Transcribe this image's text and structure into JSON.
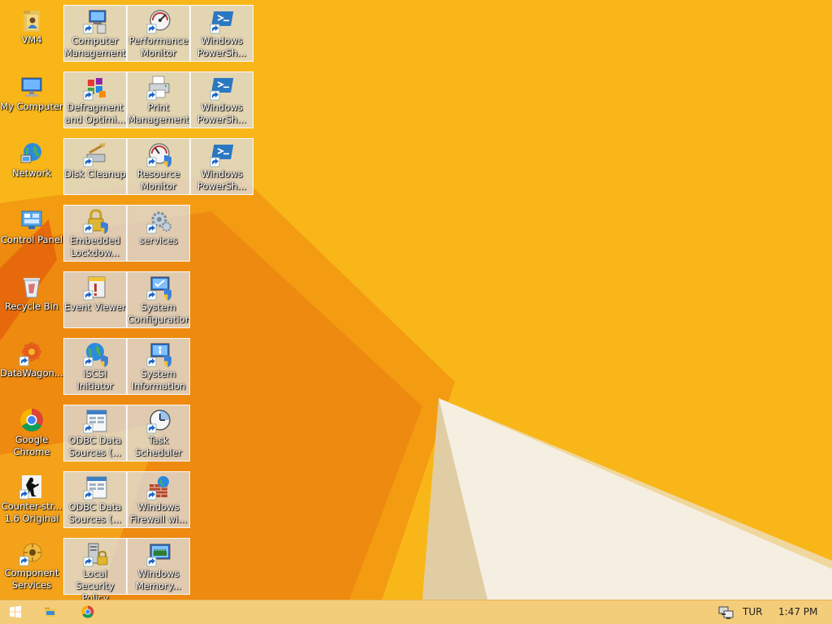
{
  "desktop": {
    "left_column": [
      {
        "name": "vm4",
        "label": "VM4",
        "icon": "folder-user-icon"
      },
      {
        "name": "my-computer",
        "label": "My Computer",
        "icon": "computer-icon"
      },
      {
        "name": "network",
        "label": "Network",
        "icon": "network-globe-icon"
      },
      {
        "name": "control-panel",
        "label": "Control Panel",
        "icon": "control-panel-icon"
      },
      {
        "name": "recycle-bin",
        "label": "Recycle Bin",
        "icon": "recycle-bin-icon"
      },
      {
        "name": "datawagon",
        "label": "DataWagon...",
        "icon": "datawagon-shortcut-icon"
      },
      {
        "name": "google-chrome",
        "label": "Google\nChrome",
        "icon": "chrome-icon"
      },
      {
        "name": "counter-strike",
        "label": "Counter-str...\n1.6 Original",
        "icon": "counter-strike-shortcut-icon"
      },
      {
        "name": "component-services",
        "label": "Component\nServices",
        "icon": "component-services-shortcut-icon"
      }
    ],
    "shortcuts": [
      {
        "name": "computer-management",
        "label": "Computer\nManagement",
        "icon": "computer-management-icon"
      },
      {
        "name": "performance-monitor",
        "label": "Performance\nMonitor",
        "icon": "performance-monitor-icon"
      },
      {
        "name": "windows-powershell-1",
        "label": "Windows\nPowerSh...",
        "icon": "powershell-icon"
      },
      {
        "name": "defragment",
        "label": "Defragment\nand Optimi...",
        "icon": "defragment-icon"
      },
      {
        "name": "print-management",
        "label": "Print\nManagement",
        "icon": "print-management-icon"
      },
      {
        "name": "windows-powershell-2",
        "label": "Windows\nPowerSh...",
        "icon": "powershell-icon"
      },
      {
        "name": "disk-cleanup",
        "label": "Disk Cleanup",
        "icon": "disk-cleanup-icon"
      },
      {
        "name": "resource-monitor",
        "label": "Resource\nMonitor",
        "icon": "resource-monitor-icon"
      },
      {
        "name": "windows-powershell-3",
        "label": "Windows\nPowerSh...",
        "icon": "powershell-icon"
      },
      {
        "name": "embedded-lockdown",
        "label": "Embedded\nLockdow...",
        "icon": "lock-shield-icon"
      },
      {
        "name": "services",
        "label": "services",
        "icon": "services-gear-icon"
      },
      {
        "name": "event-viewer",
        "label": "Event Viewer",
        "icon": "event-viewer-icon"
      },
      {
        "name": "system-configuration",
        "label": "System\nConfiguration",
        "icon": "system-configuration-icon"
      },
      {
        "name": "iscsi-initiator",
        "label": "iSCSI Initiator",
        "icon": "iscsi-globe-icon"
      },
      {
        "name": "system-information",
        "label": "System\nInformation",
        "icon": "system-information-icon"
      },
      {
        "name": "odbc-data-sources-1",
        "label": "ODBC Data\nSources (...",
        "icon": "odbc-icon"
      },
      {
        "name": "task-scheduler",
        "label": "Task\nScheduler",
        "icon": "task-scheduler-clock-icon"
      },
      {
        "name": "odbc-data-sources-2",
        "label": "ODBC Data\nSources (...",
        "icon": "odbc-icon"
      },
      {
        "name": "windows-firewall",
        "label": "Windows\nFirewall wi...",
        "icon": "firewall-icon"
      },
      {
        "name": "local-security-policy",
        "label": "Local Security\nPolicy",
        "icon": "local-security-policy-icon"
      },
      {
        "name": "windows-memory",
        "label": "Windows\nMemory...",
        "icon": "memory-diagnostic-icon"
      }
    ]
  },
  "taskbar": {
    "buttons": [
      {
        "name": "start-button",
        "icon": "windows-logo-icon"
      },
      {
        "name": "file-explorer-button",
        "icon": "file-explorer-icon"
      },
      {
        "name": "chrome-taskbar-button",
        "icon": "chrome-icon"
      }
    ],
    "tray": {
      "network_icon": "network-tray-icon",
      "language": "TUR",
      "time": "1:47 PM"
    }
  },
  "colors": {
    "wallpaper": "#F8B619",
    "taskbar": "#F4CD7B",
    "selection": "#DEDEDE"
  }
}
